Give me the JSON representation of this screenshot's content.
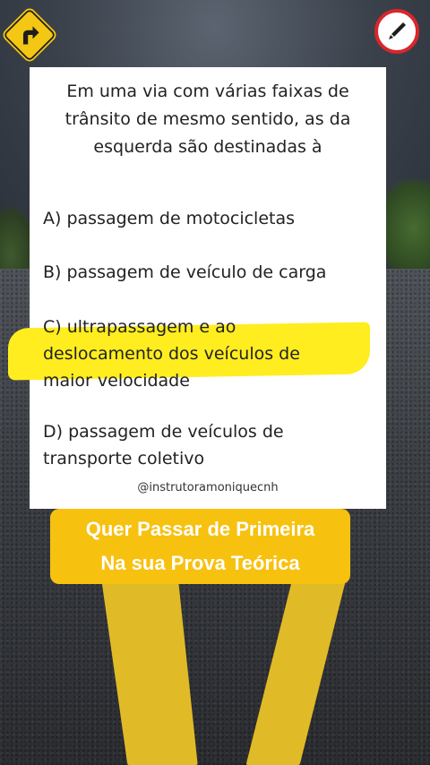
{
  "question": {
    "line1": "Em uma via com várias faixas de",
    "line2": "trânsito de mesmo sentido, as da",
    "line3": "esquerda são destinadas à"
  },
  "options": [
    {
      "lines": [
        "A) passagem de motocicletas"
      ]
    },
    {
      "lines": [
        "B) passagem de veículo de carga"
      ]
    },
    {
      "lines": [
        "C) ultrapassagem e ao",
        "deslocamento dos veículos de",
        "maior velocidade"
      ]
    },
    {
      "lines": [
        "D) passagem de veículos de",
        "transporte coletivo"
      ]
    }
  ],
  "handle": "@instrutoramoniquecnh",
  "banner": {
    "line1": "Quer Passar de Primeira",
    "line2": "Na sua Prova Teórica"
  },
  "icons": {
    "top_left": "road-sign-turn-icon",
    "top_right": "edit-pencil-icon"
  },
  "colors": {
    "highlight": "#ffed1f",
    "banner": "#f7c110",
    "lane": "#e0bb27",
    "edit_ring": "#d8262c"
  }
}
